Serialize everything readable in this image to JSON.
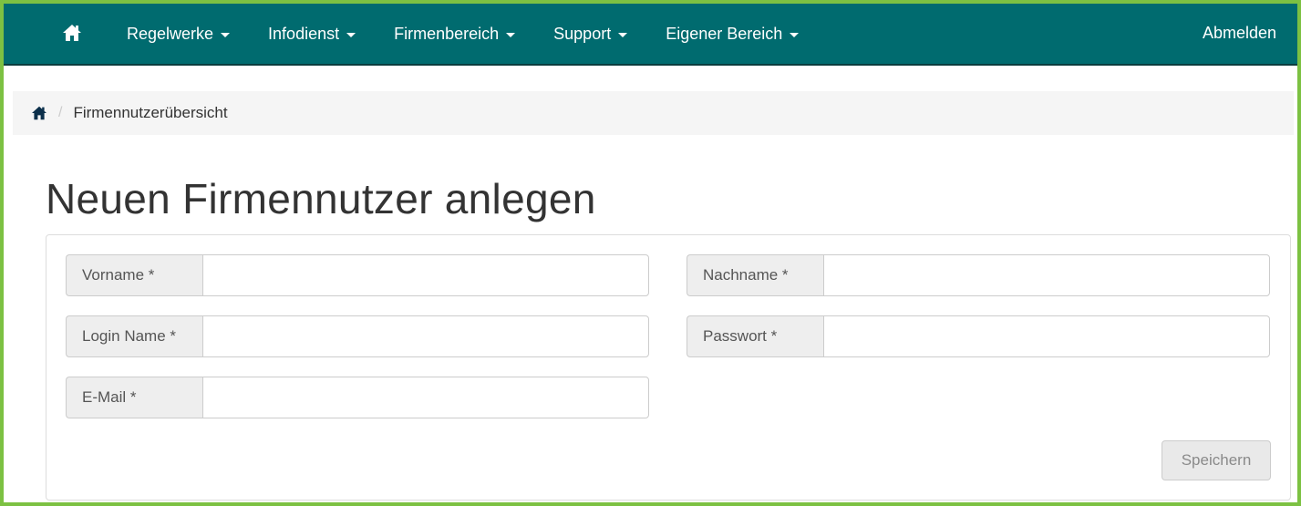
{
  "navbar": {
    "home_icon": "home-icon",
    "items": [
      {
        "label": "Regelwerke"
      },
      {
        "label": "Infodienst"
      },
      {
        "label": "Firmenbereich"
      },
      {
        "label": "Support"
      },
      {
        "label": "Eigener Bereich"
      }
    ],
    "logout_label": "Abmelden",
    "background_color": "#006b6f"
  },
  "breadcrumb": {
    "home_icon": "home-icon",
    "separator": "/",
    "current": "Firmennutzerübersicht"
  },
  "page": {
    "title": "Neuen Firmennutzer anlegen"
  },
  "form": {
    "fields": {
      "first_name": {
        "label": "Vorname *",
        "value": ""
      },
      "last_name": {
        "label": "Nachname *",
        "value": ""
      },
      "login_name": {
        "label": "Login Name *",
        "value": ""
      },
      "password": {
        "label": "Passwort *",
        "value": ""
      },
      "email": {
        "label": "E-Mail *",
        "value": ""
      }
    },
    "save_label": "Speichern"
  },
  "colors": {
    "frame_border": "#7cc142",
    "navbar": "#006b6f"
  }
}
